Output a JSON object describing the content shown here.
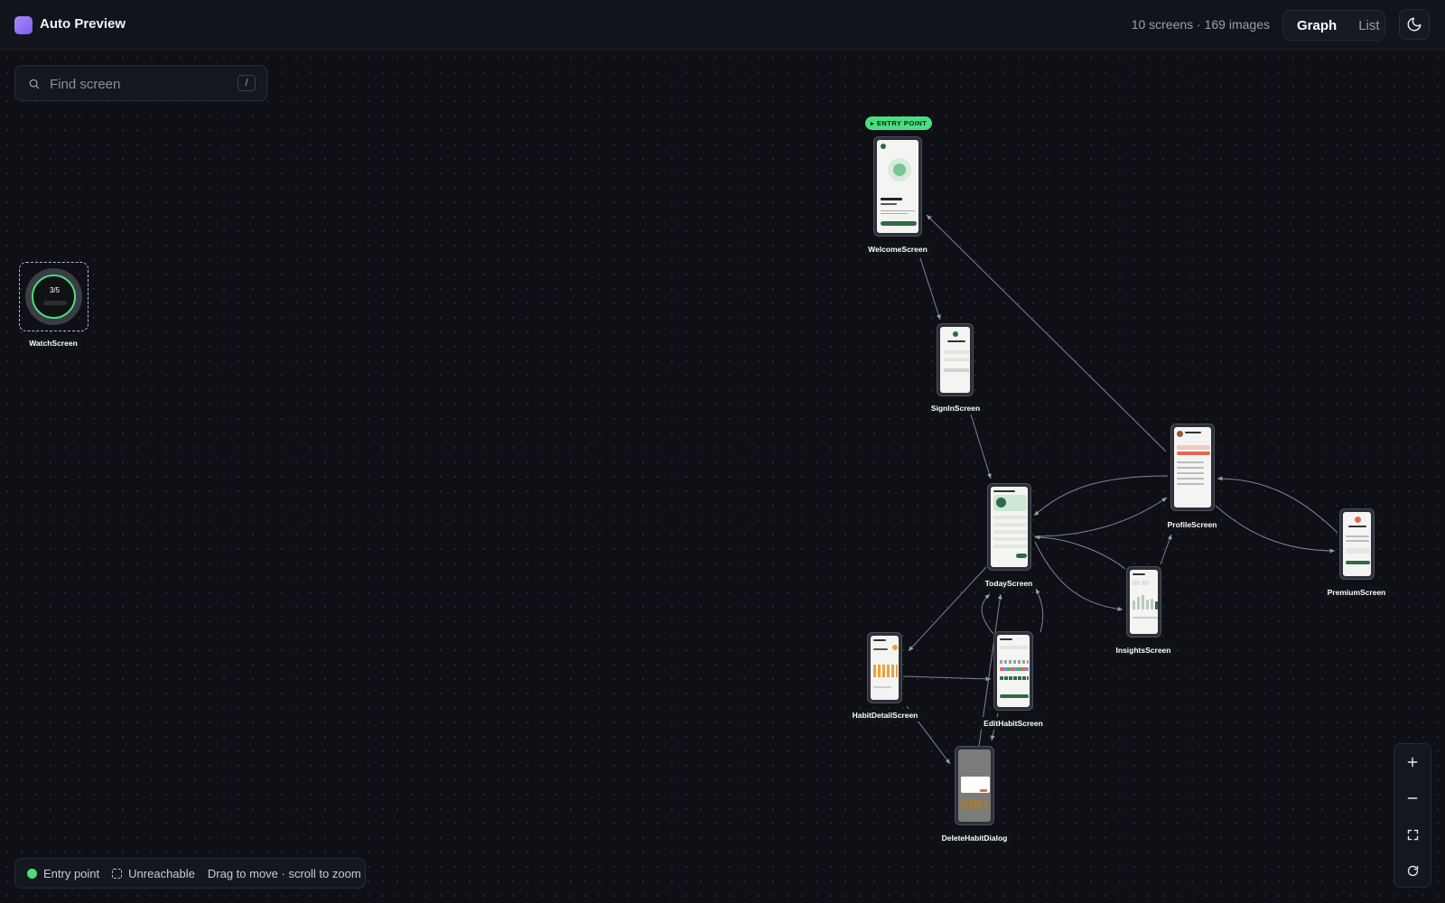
{
  "app": {
    "title": "Auto Preview"
  },
  "header": {
    "stats": "10 screens · 169 images",
    "views": [
      "Graph",
      "List"
    ],
    "active_view": "Graph"
  },
  "search": {
    "placeholder": "Find screen",
    "shortcut": "/"
  },
  "entry_badge": "▸ ENTRY POINT",
  "screens": {
    "welcome": "WelcomeScreen",
    "signin": "SignInScreen",
    "today": "TodayScreen",
    "profile": "ProfileScreen",
    "premium": "PremiumScreen",
    "insights": "InsightsScreen",
    "habit_detail": "HabitDetailScreen",
    "edit_habit": "EditHabitScreen",
    "delete_dialog": "DeleteHabitDialog",
    "watch": "WatchScreen"
  },
  "watch_content": {
    "progress": "3/5"
  },
  "legend": {
    "entry": "Entry point",
    "unreachable": "Unreachable",
    "hint": "Drag to move · scroll to zoom"
  },
  "colors": {
    "accent": "#7c5cf0",
    "entry": "#4ade80",
    "phone_green": "#2e6b45",
    "edge": "#8a8f9a"
  },
  "icons": {
    "theme": "moon-icon",
    "search": "search-icon",
    "zoom_in": "plus-icon",
    "zoom_out": "minus-icon",
    "fit": "fit-view-icon",
    "reset": "reset-icon"
  }
}
